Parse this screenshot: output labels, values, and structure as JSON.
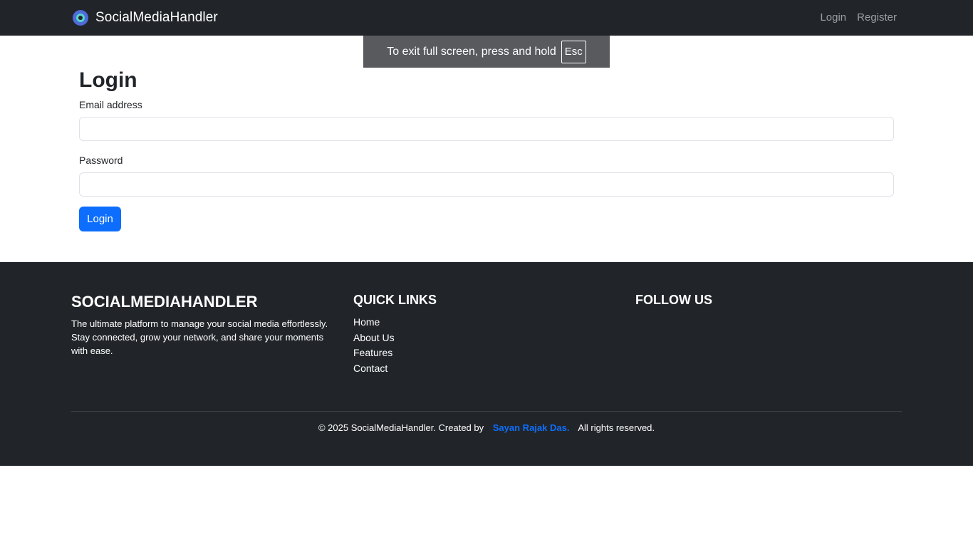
{
  "navbar": {
    "brand": "SocialMediaHandler",
    "brand_icon": "app-logo-icon",
    "links": [
      "Login",
      "Register"
    ]
  },
  "fullscreen_notice": {
    "text": "To exit full screen, press and hold",
    "key": "Esc"
  },
  "login_form": {
    "title": "Login",
    "email_label": "Email address",
    "email_value": "",
    "password_label": "Password",
    "password_value": "",
    "submit_label": "Login"
  },
  "footer": {
    "brand_title": "SOCIALMEDIAHANDLER",
    "description": "The ultimate platform to manage your social media effortlessly. Stay connected, grow your network, and share your moments with ease.",
    "quick_links_title": "QUICK LINKS",
    "quick_links": [
      "Home",
      "About Us",
      "Features",
      "Contact"
    ],
    "follow_title": "FOLLOW US",
    "copyright_prefix": "© 2025 SocialMediaHandler. Created by",
    "author": "Sayan Rajak Das.",
    "copyright_suffix": "All rights reserved."
  },
  "colors": {
    "dark": "#212529",
    "primary": "#0d6efd",
    "toast": "#585a5e"
  }
}
